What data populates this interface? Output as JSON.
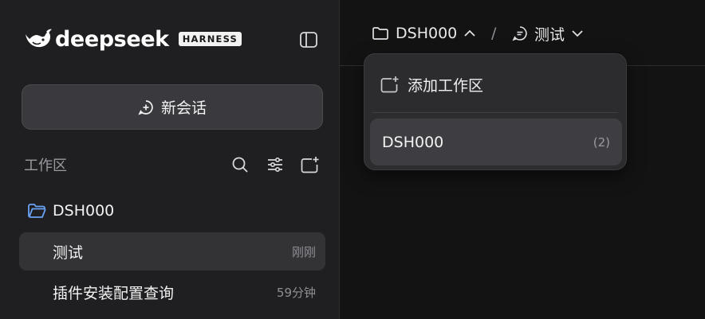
{
  "brand": {
    "name": "deepseek",
    "badge": "HARNESS"
  },
  "sidebar": {
    "new_chat_label": "新会话",
    "workspace_label": "工作区",
    "workspace_folder": "DSH000",
    "conversations": [
      {
        "title": "测试",
        "time": "刚刚"
      },
      {
        "title": "插件安装配置查询",
        "time": "59分钟"
      }
    ]
  },
  "breadcrumb": {
    "workspace": "DSH000",
    "separator": "/",
    "conversation": "测试"
  },
  "dropdown": {
    "add_label": "添加工作区",
    "items": [
      {
        "name": "DSH000",
        "count": "(2)"
      }
    ]
  },
  "colors": {
    "folder_accent": "#6aa2f5",
    "sidebar_bg": "#1f1f21",
    "main_bg": "#131314"
  },
  "icons": [
    "whale-logo-icon",
    "sidebar-toggle-icon",
    "add-chat-icon",
    "search-icon",
    "filter-icon",
    "new-folder-icon",
    "folder-icon",
    "chevron-up-icon",
    "chat-bubble-icon",
    "chevron-down-icon"
  ]
}
